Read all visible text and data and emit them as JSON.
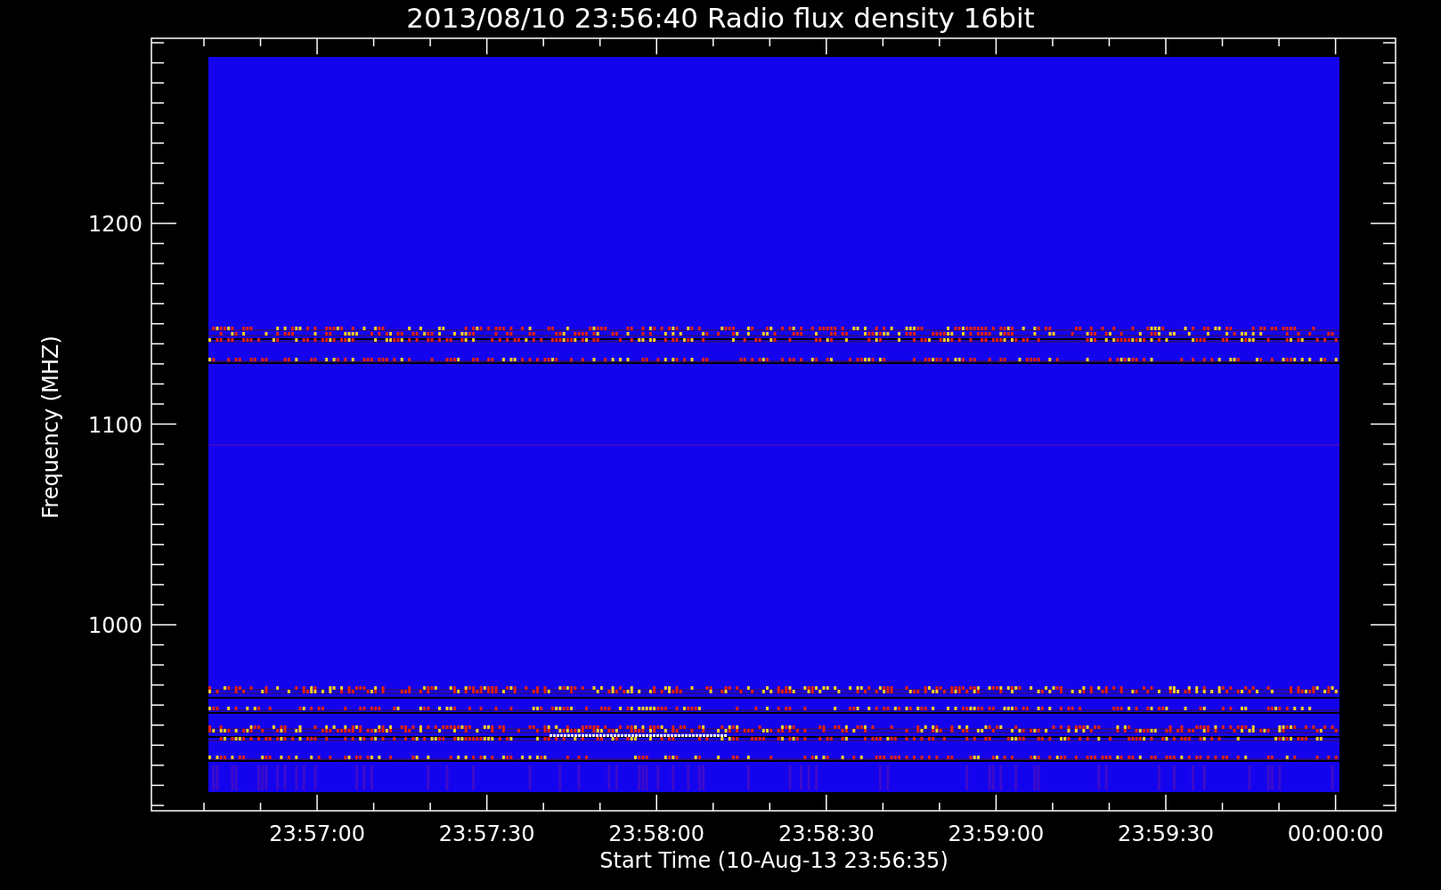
{
  "title": "2013/08/10 23:56:40 Radio flux density 16bit",
  "y_axis": {
    "label": "Frequency (MHZ)",
    "ticks": [
      "1200",
      "1100",
      "1000"
    ]
  },
  "x_axis": {
    "label": "Start Time (10-Aug-13 23:56:35)",
    "ticks": [
      "23:57:00",
      "23:57:30",
      "23:58:00",
      "23:58:30",
      "23:59:00",
      "23:59:30",
      "00:00:00"
    ]
  }
}
